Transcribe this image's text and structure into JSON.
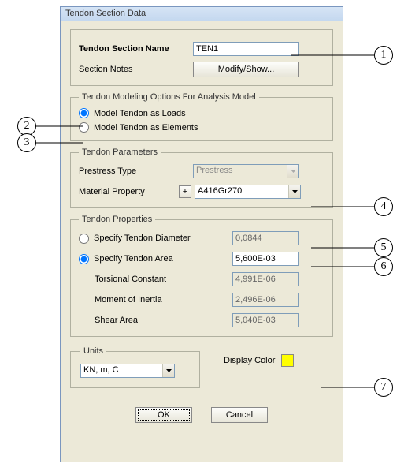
{
  "title": "Tendon Section Data",
  "top": {
    "name_label": "Tendon Section Name",
    "name_value": "TEN1",
    "notes_label": "Section Notes",
    "notes_button": "Modify/Show..."
  },
  "modeling": {
    "legend": "Tendon Modeling Options For Analysis Model",
    "opt_loads": "Model Tendon as Loads",
    "opt_elements": "Model Tendon as Elements"
  },
  "params": {
    "legend": "Tendon Parameters",
    "prestress_label": "Prestress Type",
    "prestress_value": "Prestress",
    "material_label": "Material Property",
    "plus_label": "+",
    "material_value": "A416Gr270"
  },
  "props": {
    "legend": "Tendon Properties",
    "opt_dia": "Specify Tendon Diameter",
    "dia_value": "0,0844",
    "opt_area": "Specify Tendon Area",
    "area_value": "5,600E-03",
    "torsional_label": "Torsional Constant",
    "torsional_value": "4,991E-06",
    "moment_label": "Moment of Inertia",
    "moment_value": "2,496E-06",
    "shear_label": "Shear Area",
    "shear_value": "5,040E-03"
  },
  "units": {
    "legend": "Units",
    "value": "KN, m, C"
  },
  "display_color_label": "Display Color",
  "display_color": "#ffff00",
  "buttons": {
    "ok": "OK",
    "cancel": "Cancel"
  },
  "callouts": {
    "c1": "1",
    "c2": "2",
    "c3": "3",
    "c4": "4",
    "c5": "5",
    "c6": "6",
    "c7": "7"
  }
}
